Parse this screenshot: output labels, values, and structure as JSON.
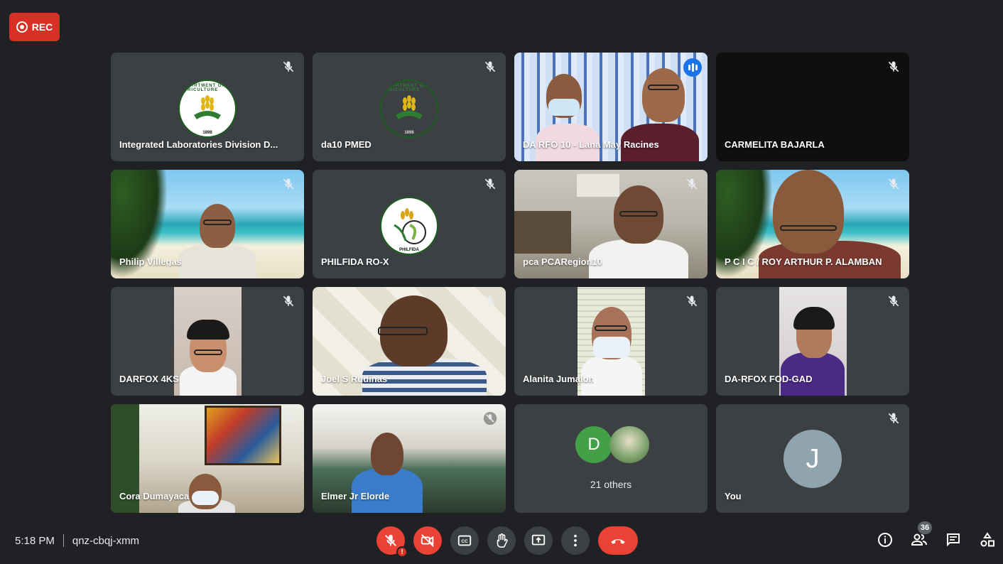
{
  "recording": {
    "label": "REC"
  },
  "meeting": {
    "time": "5:18 PM",
    "code": "qnz-cbqj-xmm"
  },
  "tiles": [
    {
      "name": "Integrated Laboratories Division D...",
      "muted": true,
      "kind": "logo"
    },
    {
      "name": "da10 PMED",
      "muted": true,
      "kind": "logo"
    },
    {
      "name": "DA RFO 10 - Lana May Racines",
      "muted": false,
      "speaking": true,
      "kind": "video"
    },
    {
      "name": "CARMELITA BAJARLA",
      "muted": true,
      "kind": "blank"
    },
    {
      "name": "Philip Villegas",
      "muted": true,
      "kind": "video"
    },
    {
      "name": "PHILFIDA RO-X",
      "muted": true,
      "kind": "logo"
    },
    {
      "name": "pca PCARegion10",
      "muted": true,
      "kind": "video"
    },
    {
      "name": "P C I C / ROY ARTHUR P. ALAMBAN",
      "muted": true,
      "kind": "video"
    },
    {
      "name": "DARFOX 4KS",
      "muted": true,
      "kind": "video"
    },
    {
      "name": "Joel S Rudinas",
      "muted": true,
      "kind": "video"
    },
    {
      "name": "Alanita Jumalon",
      "muted": true,
      "kind": "video"
    },
    {
      "name": "DA-RFOX FOD-GAD",
      "muted": true,
      "kind": "video"
    },
    {
      "name": "Cora Dumayaca",
      "muted": true,
      "kind": "video"
    },
    {
      "name": "Elmer Jr Elorde",
      "muted": true,
      "kind": "video"
    },
    {
      "name": "21 others",
      "kind": "others",
      "avatar_letter": "D"
    },
    {
      "name": "You",
      "muted": true,
      "kind": "self",
      "avatar_letter": "J"
    }
  ],
  "logo_text": {
    "department": "DEPARTMENT OF AGRICULTURE",
    "year": "1898",
    "philfida": "PHILFIDA"
  },
  "participants_count": "36",
  "colors": {
    "background": "#202124",
    "tile": "#3c4043",
    "danger": "#ea4335",
    "active_border": "#8ab4f8",
    "avatar_d": "#43a047",
    "avatar_j": "#90a4ae"
  },
  "icons": {
    "mic_off": "mic-off-icon",
    "camera_off": "camera-off-icon",
    "captions": "captions-icon",
    "raise_hand": "raise-hand-icon",
    "present": "present-screen-icon",
    "more": "more-options-icon",
    "hang_up": "hang-up-icon",
    "info": "info-icon",
    "people": "people-icon",
    "chat": "chat-icon",
    "activities": "activities-icon"
  }
}
